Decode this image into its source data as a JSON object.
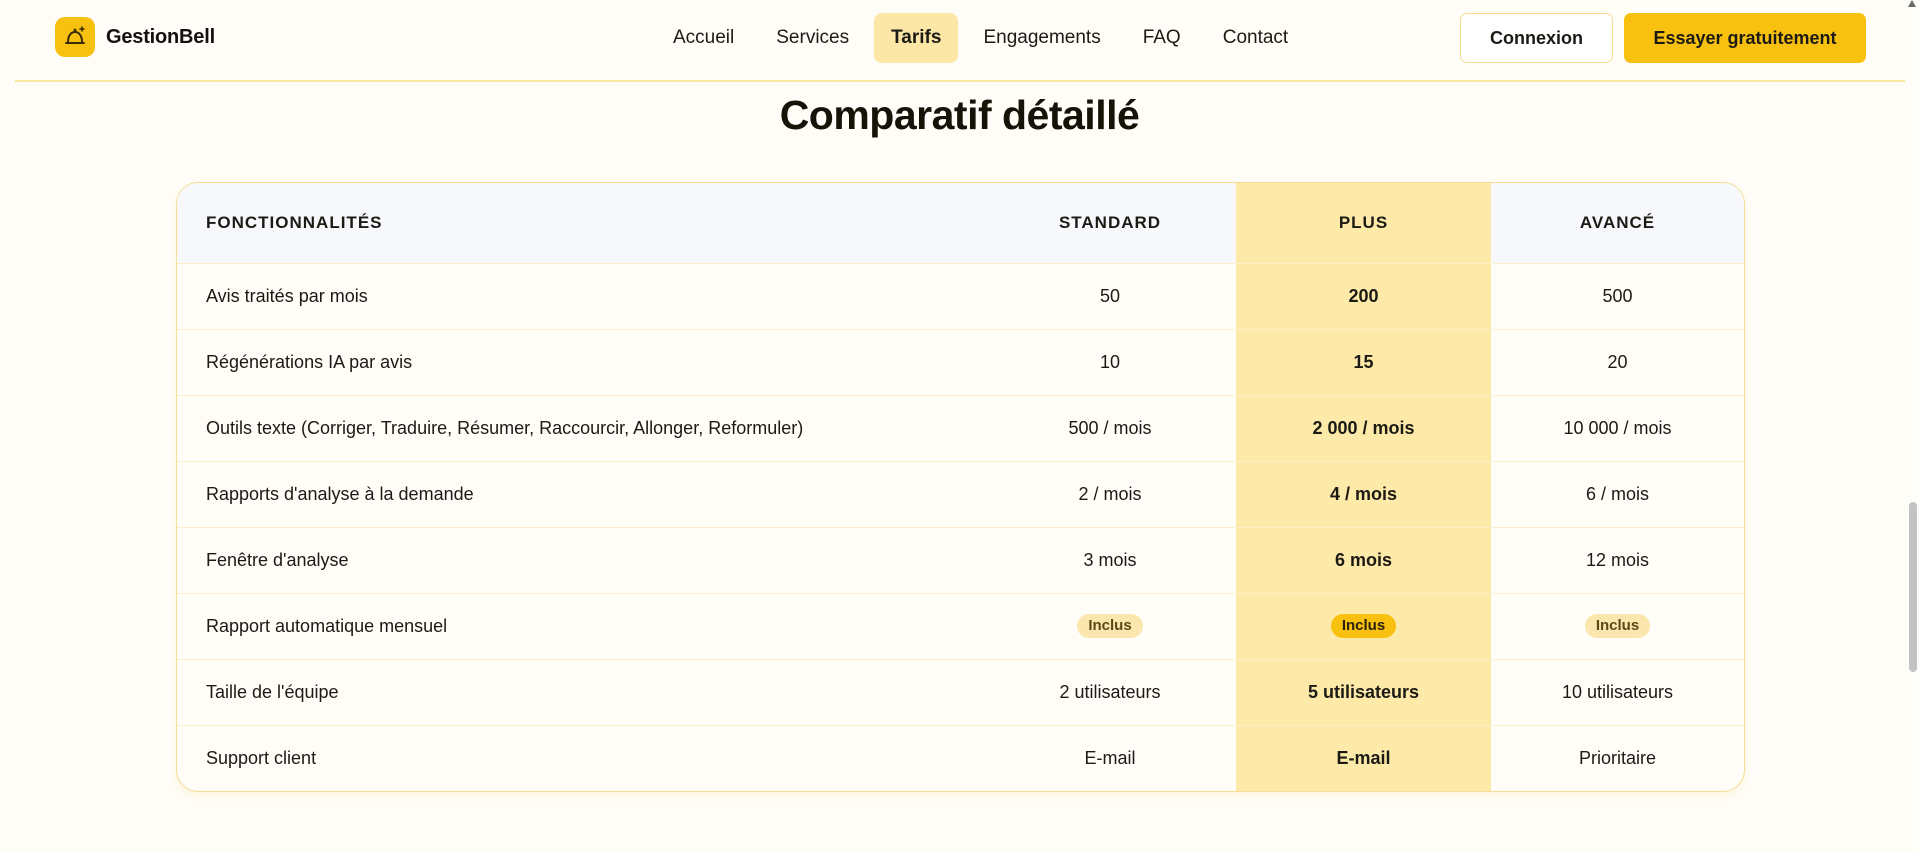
{
  "header": {
    "brand": "GestionBell",
    "nav": [
      {
        "label": "Accueil",
        "active": false
      },
      {
        "label": "Services",
        "active": false
      },
      {
        "label": "Tarifs",
        "active": true
      },
      {
        "label": "Engagements",
        "active": false
      },
      {
        "label": "FAQ",
        "active": false
      },
      {
        "label": "Contact",
        "active": false
      }
    ],
    "login_label": "Connexion",
    "trial_label": "Essayer gratuitement"
  },
  "title": "Comparatif détaillé",
  "table": {
    "headers": [
      "FONCTIONNALITÉS",
      "STANDARD",
      "PLUS",
      "AVANCÉ"
    ],
    "rows": [
      {
        "feature": "Avis traités par mois",
        "standard": "50",
        "plus": "200",
        "avance": "500"
      },
      {
        "feature": "Régénérations IA par avis",
        "standard": "10",
        "plus": "15",
        "avance": "20"
      },
      {
        "feature": "Outils texte (Corriger, Traduire, Résumer, Raccourcir, Allonger, Reformuler)",
        "standard": "500 / mois",
        "plus": "2 000 / mois",
        "avance": "10 000 / mois"
      },
      {
        "feature": "Rapports d'analyse à la demande",
        "standard": "2 / mois",
        "plus": "4 / mois",
        "avance": "6 / mois"
      },
      {
        "feature": "Fenêtre d'analyse",
        "standard": "3 mois",
        "plus": "6 mois",
        "avance": "12 mois"
      },
      {
        "feature": "Rapport automatique mensuel",
        "standard": "Inclus",
        "plus": "Inclus",
        "avance": "Inclus",
        "badge": true
      },
      {
        "feature": "Taille de l'équipe",
        "standard": "2 utilisateurs",
        "plus": "5 utilisateurs",
        "avance": "10 utilisateurs"
      },
      {
        "feature": "Support client",
        "standard": "E-mail",
        "plus": "E-mail",
        "avance": "Prioritaire"
      }
    ]
  },
  "colors": {
    "accent": "#f8c10f",
    "highlight": "#fde9a8",
    "background": "#fffdf8"
  },
  "icons": {
    "logo": "bell-icon"
  }
}
